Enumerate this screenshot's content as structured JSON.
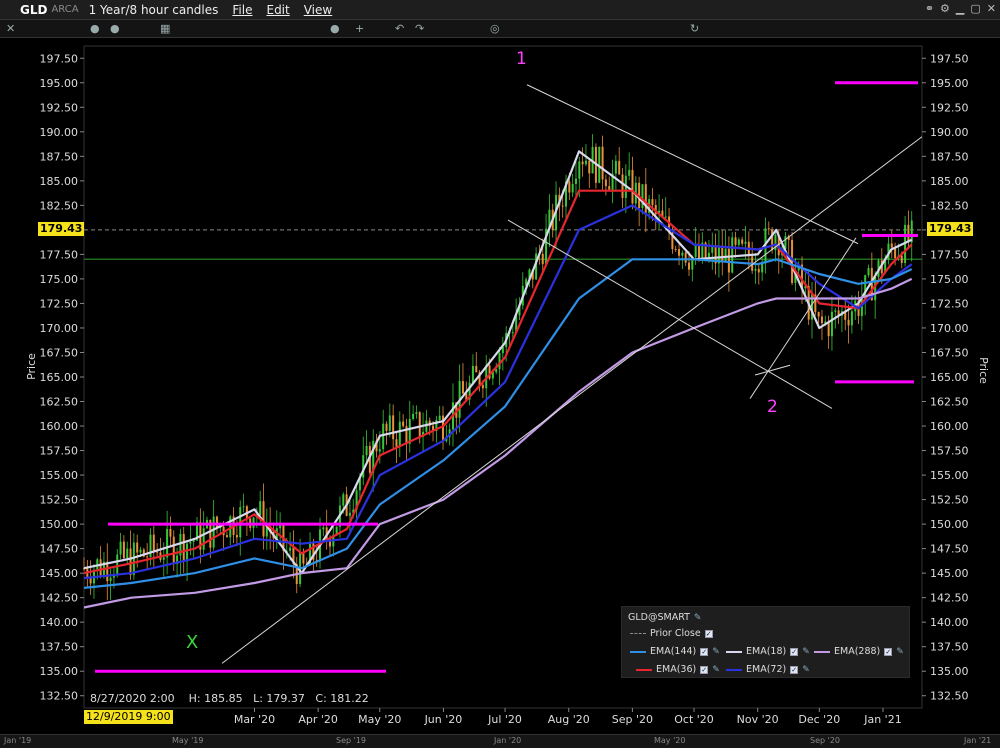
{
  "window": {
    "symbol": "GLD",
    "exchange": "ARCA",
    "timeframe": "1 Year/8 hour candles",
    "menu": [
      "File",
      "Edit",
      "View"
    ]
  },
  "colors": {
    "background": "#000000",
    "ema144": "#2f8fe6",
    "ema18": "#d8d8ee",
    "ema288": "#c29ae6",
    "ema36": "#e8262e",
    "ema72": "#2a32e0",
    "up_candle": "#39c739",
    "down_candle": "#e8913a",
    "level_line": "#ff00ff",
    "trend_line": "#d8d8d8",
    "prior_close": "#8a8a8a",
    "horizontal_green": "#1f6b1f",
    "price_tag": "#f5e21b"
  },
  "axis": {
    "y_ticks": [
      "197.50",
      "195.00",
      "192.50",
      "190.00",
      "187.50",
      "185.00",
      "182.50",
      "180.00",
      "177.50",
      "175.00",
      "172.50",
      "170.00",
      "167.50",
      "165.00",
      "162.50",
      "160.00",
      "157.50",
      "155.00",
      "152.50",
      "150.00",
      "147.50",
      "145.00",
      "142.50",
      "140.00",
      "137.50",
      "135.00",
      "132.50"
    ],
    "y_title": "Price",
    "x_ticks": [
      "Mar '20",
      "Apr '20",
      "May '20",
      "Jun '20",
      "Jul '20",
      "Aug '20",
      "Sep '20",
      "Oct '20",
      "Nov '20",
      "Dec '20",
      "Jan '21"
    ],
    "start_date": "12/9/2019 9:00",
    "current_price": "179.43"
  },
  "ohlc": {
    "date": "8/27/2020 2:00",
    "high": "H: 185.85",
    "low": "L: 179.37",
    "close": "C: 181.22"
  },
  "legend": {
    "title": "GLD@SMART",
    "items": [
      {
        "label": "Prior Close"
      },
      {
        "label": "EMA(144)"
      },
      {
        "label": "EMA(18)"
      },
      {
        "label": "EMA(288)"
      },
      {
        "label": "EMA(36)"
      },
      {
        "label": "EMA(72)"
      }
    ]
  },
  "annotations": {
    "wave_x": "X",
    "wave_1": "1",
    "wave_2": "2"
  },
  "overview_ticks": [
    "Jan '19",
    "May '19",
    "Sep '19",
    "Jan '20",
    "May '20",
    "Sep '20",
    "Jan '21"
  ],
  "chart_data": {
    "type": "line",
    "title": "",
    "ylabel": "Price",
    "ylim": [
      131.25,
      198.75
    ],
    "x_dates": [
      "2019-12-09",
      "2020-01-01",
      "2020-02-01",
      "2020-03-01",
      "2020-03-24",
      "2020-04-15",
      "2020-05-01",
      "2020-06-01",
      "2020-07-01",
      "2020-08-06",
      "2020-09-01",
      "2020-10-01",
      "2020-11-01",
      "2020-11-10",
      "2020-12-01",
      "2020-12-20",
      "2021-01-05",
      "2021-01-15"
    ],
    "series": [
      {
        "name": "EMA(18)",
        "values": [
          145.5,
          146.5,
          148.5,
          151.5,
          145.0,
          152.0,
          159.0,
          160.5,
          168.5,
          188.0,
          184.0,
          177.0,
          177.5,
          180.0,
          170.0,
          172.5,
          178.0,
          179.0
        ]
      },
      {
        "name": "EMA(36)",
        "values": [
          145.0,
          146.0,
          147.5,
          151.0,
          147.0,
          149.5,
          157.0,
          160.0,
          167.0,
          184.0,
          184.0,
          178.5,
          178.0,
          178.5,
          172.5,
          172.0,
          176.5,
          178.5
        ]
      },
      {
        "name": "EMA(72)",
        "values": [
          144.5,
          145.0,
          146.5,
          148.5,
          148.0,
          148.5,
          155.0,
          158.5,
          164.5,
          180.0,
          182.5,
          178.5,
          178.0,
          178.5,
          174.5,
          172.0,
          175.0,
          176.5
        ]
      },
      {
        "name": "EMA(144)",
        "values": [
          143.5,
          144.0,
          145.0,
          146.5,
          145.5,
          147.5,
          152.0,
          156.5,
          162.0,
          173.0,
          177.0,
          177.0,
          176.5,
          177.0,
          175.5,
          174.5,
          175.0,
          176.0
        ]
      },
      {
        "name": "EMA(288)",
        "values": [
          141.5,
          142.5,
          143.0,
          144.0,
          145.0,
          145.5,
          150.0,
          152.5,
          157.0,
          163.5,
          167.5,
          170.0,
          172.5,
          173.0,
          173.0,
          173.0,
          174.0,
          175.0
        ]
      }
    ],
    "levels": [
      150.0,
      135.0,
      195.0,
      179.43,
      164.5
    ],
    "green_level": 177.0
  }
}
